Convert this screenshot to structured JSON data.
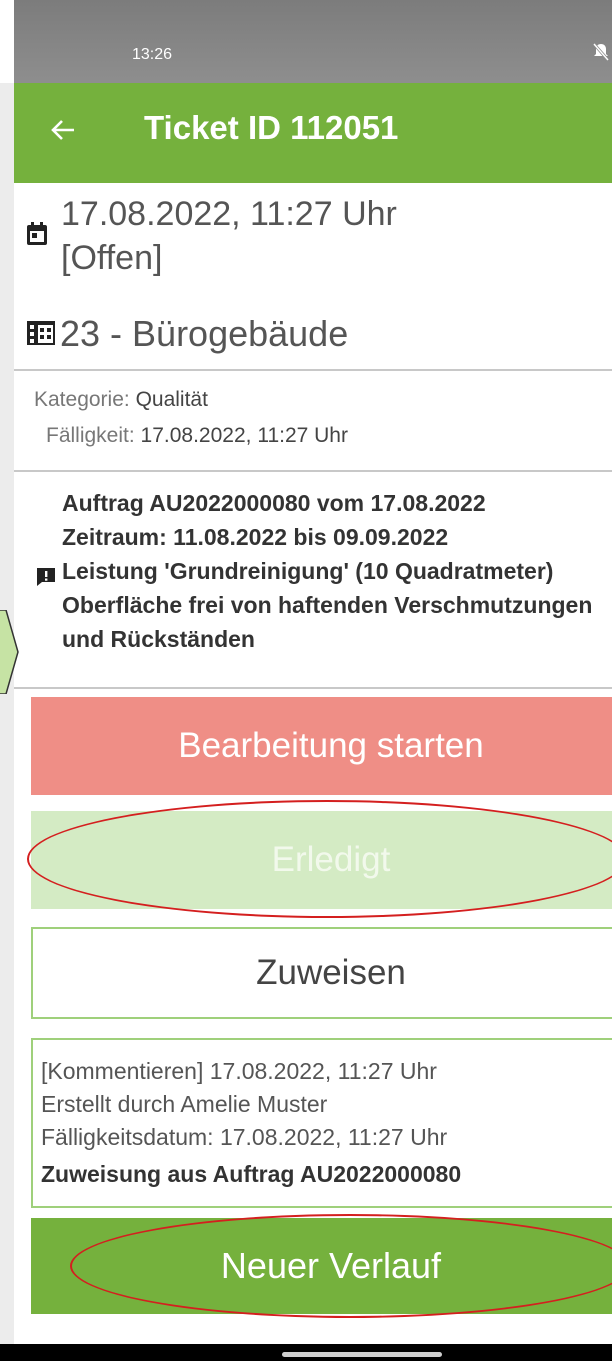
{
  "status_bar": {
    "time": "13:26",
    "icon": "notifications-off-icon"
  },
  "app_bar": {
    "back_icon": "back-arrow-icon",
    "title": "Ticket ID 112051"
  },
  "ticket": {
    "date_icon": "calendar-icon",
    "datetime": "17.08.2022, 11:27 Uhr",
    "status": "[Offen]",
    "building_icon": "building-icon",
    "building": "23 - Bürogebäude",
    "category_label": "Kategorie:",
    "category_value": "Qualität",
    "due_label": "Fälligkeit:",
    "due_value": "17.08.2022, 11:27 Uhr"
  },
  "order": {
    "line1": "Auftrag AU2022000080 vom 17.08.2022",
    "line2": "Zeitraum: 11.08.2022 bis 09.09.2022",
    "comment_icon": "comment-alert-icon",
    "line3": "Leistung 'Grundreinigung' (10 Quadratmeter)",
    "line4": "Oberfläche frei von haftenden Verschmutzungen",
    "line5": "und Rückständen"
  },
  "buttons": {
    "start": "Bearbeitung starten",
    "done": "Erledigt",
    "assign": "Zuweisen",
    "new_history": "Neuer Verlauf"
  },
  "history": {
    "line1": "[Kommentieren] 17.08.2022, 11:27 Uhr",
    "line2": "Erstellt durch Amelie Muster",
    "line3": "Fälligkeitsdatum: 17.08.2022, 11:27 Uhr",
    "line4": "Zuweisung aus Auftrag AU2022000080"
  },
  "colors": {
    "brand_green": "#75b13d",
    "start_red": "#ef8e86",
    "done_green_light": "#d4ebc4",
    "annotation_red": "#d41f1f"
  }
}
